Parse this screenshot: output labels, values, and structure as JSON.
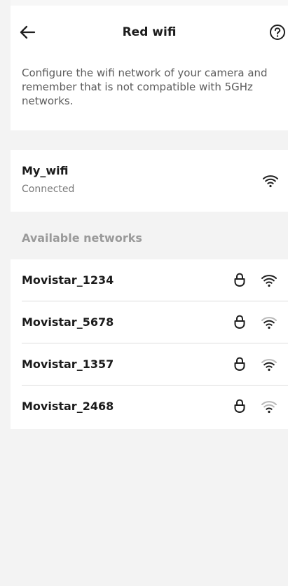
{
  "header": {
    "title": "Red wifi",
    "back_icon": "arrow-left-icon",
    "help_icon": "help-circle-icon"
  },
  "description": "Configure the wifi network of your camera and remember that is not compatible with 5GHz networks.",
  "current_network": {
    "name": "My_wifi",
    "status": "Connected",
    "icon": "wifi-icon"
  },
  "available": {
    "title": "Available networks",
    "networks": [
      {
        "name": "Movistar_1234",
        "locked": true,
        "signal_bars": 3
      },
      {
        "name": "Movistar_5678",
        "locked": true,
        "signal_bars": 2
      },
      {
        "name": "Movistar_1357",
        "locked": true,
        "signal_bars": 2
      },
      {
        "name": "Movistar_2468",
        "locked": true,
        "signal_bars": 1
      }
    ]
  },
  "colors": {
    "background": "#f3f3f3",
    "panel": "#ffffff",
    "text": "#1f1f1f",
    "muted": "#7a7a7a",
    "section_title": "#9a9a9a",
    "divider": "#dddddd",
    "wifi_strong": "#1f1f1f",
    "wifi_weak": "#b8b8b8"
  }
}
